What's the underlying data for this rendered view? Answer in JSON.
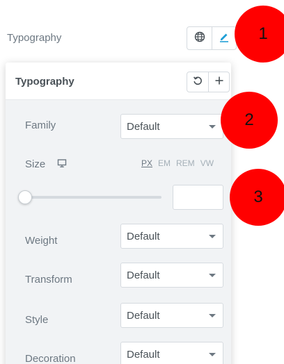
{
  "top": {
    "label": "Typography",
    "globe_icon": "globe-icon",
    "edit_icon": "pencil-icon"
  },
  "panel": {
    "title": "Typography",
    "reset_icon": "reset-icon",
    "add_icon": "plus-icon"
  },
  "fields": {
    "family": {
      "label": "Family",
      "value": "Default"
    },
    "size": {
      "label": "Size",
      "device_icon": "desktop-icon",
      "units": [
        "PX",
        "EM",
        "REM",
        "VW"
      ],
      "active_unit": "PX",
      "value": ""
    },
    "weight": {
      "label": "Weight",
      "value": "Default"
    },
    "transform": {
      "label": "Transform",
      "value": "Default"
    },
    "style": {
      "label": "Style",
      "value": "Default"
    },
    "decoration": {
      "label": "Decoration",
      "value": "Default"
    }
  },
  "annotations": [
    "1",
    "2",
    "3"
  ],
  "colors": {
    "accent": "#39b54a",
    "badge": "#ff0000",
    "panel_bg": "#f1f3f5"
  }
}
